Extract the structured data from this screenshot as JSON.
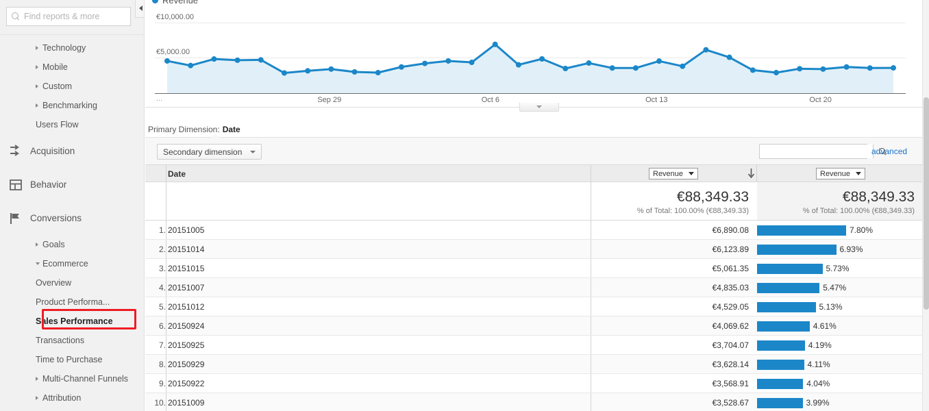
{
  "sidebar": {
    "search": {
      "placeholder": "Find reports & more",
      "value": "",
      "icon": "search-icon"
    },
    "items": [
      {
        "label": "Technology",
        "level": "sub2",
        "caret": "closed"
      },
      {
        "label": "Mobile",
        "level": "sub2",
        "caret": "closed"
      },
      {
        "label": "Custom",
        "level": "sub2",
        "caret": "closed"
      },
      {
        "label": "Benchmarking",
        "level": "sub2",
        "caret": "closed"
      },
      {
        "label": "Users Flow",
        "level": "sub3",
        "caret": "none"
      },
      {
        "label": "Acquisition",
        "level": "top",
        "caret": "none",
        "icon": "acquisition-arrows-icon"
      },
      {
        "label": "Behavior",
        "level": "top",
        "caret": "none",
        "icon": "behavior-layout-icon"
      },
      {
        "label": "Conversions",
        "level": "top",
        "caret": "none",
        "icon": "conversions-flag-icon"
      },
      {
        "label": "Goals",
        "level": "sub2",
        "caret": "closed"
      },
      {
        "label": "Ecommerce",
        "level": "sub2",
        "caret": "open"
      },
      {
        "label": "Overview",
        "level": "sub3",
        "caret": "none"
      },
      {
        "label": "Product Performa...",
        "level": "sub3",
        "caret": "none"
      },
      {
        "label": "Sales Performance",
        "level": "sub3",
        "caret": "none",
        "selected": true
      },
      {
        "label": "Transactions",
        "level": "sub3",
        "caret": "none"
      },
      {
        "label": "Time to Purchase",
        "level": "sub3",
        "caret": "none"
      },
      {
        "label": "Multi-Channel Funnels",
        "level": "sub2",
        "caret": "closed"
      },
      {
        "label": "Attribution",
        "level": "sub2",
        "caret": "closed"
      }
    ],
    "collapse_icon": "collapse-left-icon",
    "highlight_color": "#ee1c25"
  },
  "chart_data": {
    "type": "area",
    "title": "",
    "series_name": "Revenue",
    "legend_label": "Revenue",
    "legend_position": "top-left",
    "legend_color": "#1b87c9",
    "line_color": "#1b87c9",
    "fill_color": "#e1f0f8",
    "grid": true,
    "ylabel": "",
    "xlabel": "",
    "ylim": [
      0,
      11800
    ],
    "ytick_labels": [
      "€10,000.00",
      "€5,000.00"
    ],
    "ytick_values": [
      10000,
      5000
    ],
    "xtick_labels": [
      "...",
      "Sep 29",
      "Oct 6",
      "Oct 13",
      "Oct 20"
    ],
    "xtick_positions": [
      0,
      7,
      14,
      21,
      28
    ],
    "x": [
      "Sep 22",
      "Sep 23",
      "Sep 24",
      "Sep 25",
      "Sep 26",
      "Sep 27",
      "Sep 28",
      "Sep 29",
      "Sep 30",
      "Oct 1",
      "Oct 2",
      "Oct 3",
      "Oct 4",
      "Oct 5",
      "Oct 6",
      "Oct 7",
      "Oct 8",
      "Oct 9",
      "Oct 10",
      "Oct 11",
      "Oct 12",
      "Oct 13",
      "Oct 14",
      "Oct 15",
      "Oct 16",
      "Oct 17",
      "Oct 18",
      "Oct 19",
      "Oct 20",
      "Oct 21",
      "Oct 22",
      "Oct 23"
    ],
    "values": [
      4550,
      3900,
      4820,
      4650,
      4700,
      2850,
      3150,
      3400,
      3000,
      2900,
      3700,
      4200,
      4550,
      4350,
      6890,
      4000,
      4835,
      3480,
      4250,
      3550,
      3550,
      4529,
      3800,
      6123,
      5061,
      3250,
      2900,
      3450,
      3400,
      3700,
      3550,
      3570
    ],
    "currency": "€"
  },
  "primary_dimension": {
    "label": "Primary Dimension:",
    "value": "Date"
  },
  "toolbar": {
    "secondary_dimension_label": "Secondary dimension",
    "secondary_dimension_icon": "chevron-down-icon",
    "search_value": "",
    "search_placeholder": "",
    "search_icon": "search-icon",
    "advanced_label": "advanced"
  },
  "table": {
    "column_date_header": "Date",
    "metric_select_1": "Revenue",
    "metric_select_2": "Revenue",
    "metric_select_icon": "chevron-down-icon",
    "sort_icon": "sort-descending-arrow-icon",
    "summary": {
      "value_1": "€88,349.33",
      "sub_1": "% of Total: 100.00% (€88,349.33)",
      "value_2": "€88,349.33",
      "sub_2": "% of Total: 100.00% (€88,349.33)"
    },
    "bar_color": "#1b87c9",
    "bar_max_pct": 7.8,
    "rows": [
      {
        "index": "1.",
        "date": "20151005",
        "revenue": "€6,890.08",
        "pct_label": "7.80%",
        "pct": 7.8
      },
      {
        "index": "2.",
        "date": "20151014",
        "revenue": "€6,123.89",
        "pct_label": "6.93%",
        "pct": 6.93
      },
      {
        "index": "3.",
        "date": "20151015",
        "revenue": "€5,061.35",
        "pct_label": "5.73%",
        "pct": 5.73
      },
      {
        "index": "4.",
        "date": "20151007",
        "revenue": "€4,835.03",
        "pct_label": "5.47%",
        "pct": 5.47
      },
      {
        "index": "5.",
        "date": "20151012",
        "revenue": "€4,529.05",
        "pct_label": "5.13%",
        "pct": 5.13
      },
      {
        "index": "6.",
        "date": "20150924",
        "revenue": "€4,069.62",
        "pct_label": "4.61%",
        "pct": 4.61
      },
      {
        "index": "7.",
        "date": "20150925",
        "revenue": "€3,704.07",
        "pct_label": "4.19%",
        "pct": 4.19
      },
      {
        "index": "8.",
        "date": "20150929",
        "revenue": "€3,628.14",
        "pct_label": "4.11%",
        "pct": 4.11
      },
      {
        "index": "9.",
        "date": "20150922",
        "revenue": "€3,568.91",
        "pct_label": "4.04%",
        "pct": 4.04
      },
      {
        "index": "10.",
        "date": "20151009",
        "revenue": "€3,528.67",
        "pct_label": "3.99%",
        "pct": 3.99
      }
    ]
  }
}
